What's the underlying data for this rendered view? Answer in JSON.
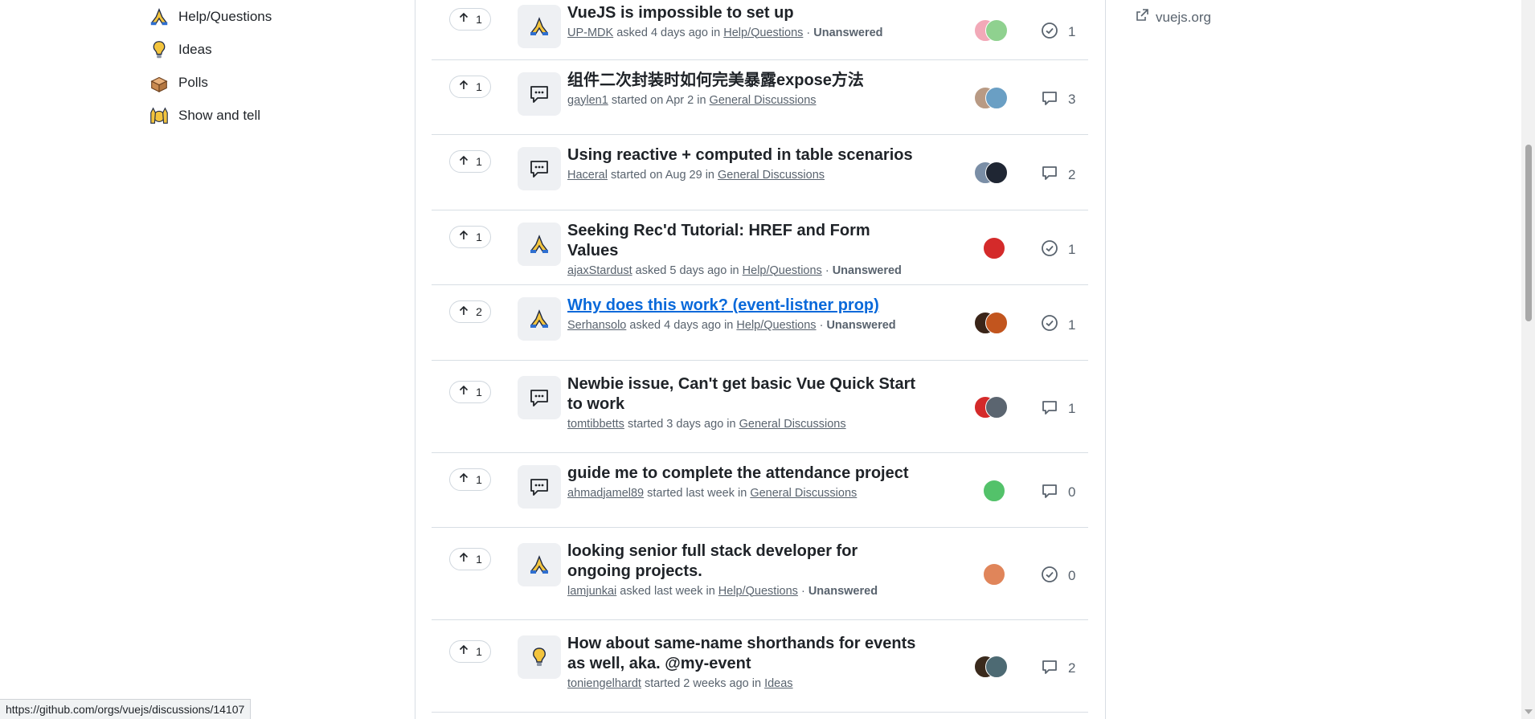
{
  "nav": {
    "items": [
      {
        "label": "Help/Questions",
        "icon": "folded-hands-icon"
      },
      {
        "label": "Ideas",
        "icon": "lightbulb-icon"
      },
      {
        "label": "Polls",
        "icon": "ballot-box-icon"
      },
      {
        "label": "Show and tell",
        "icon": "raising-hands-icon"
      }
    ]
  },
  "sidebar": {
    "link_label": "vuejs.org",
    "link_icon": "external-link-icon"
  },
  "discussions": [
    {
      "votes": "1",
      "category_icon": "folded-hands-icon",
      "title": "VueJS is impossible to set up",
      "author": "UP-MDK",
      "action": "asked 4 days ago in",
      "category": "Help/Questions",
      "status": "Unanswered",
      "count_icon": "check-circle-icon",
      "count": "1",
      "avatar_colors": [
        "#f2a9b8",
        "#8fd18f"
      ]
    },
    {
      "votes": "1",
      "category_icon": "speech-bubble-icon",
      "title": "组件二次封装时如何完美暴露expose方法",
      "author": "gaylen1",
      "action": "started on Apr 2 in",
      "category": "General Discussions",
      "status": "",
      "count_icon": "comment-icon",
      "count": "3",
      "avatar_colors": [
        "#b89a84",
        "#6a9fc4"
      ]
    },
    {
      "votes": "1",
      "category_icon": "speech-bubble-icon",
      "title": "Using reactive + computed in table scenarios",
      "author": "Haceral",
      "action": "started on Aug 29 in",
      "category": "General Discussions",
      "status": "",
      "count_icon": "comment-icon",
      "count": "2",
      "avatar_colors": [
        "#7a8ea6",
        "#1f2633"
      ]
    },
    {
      "votes": "1",
      "category_icon": "folded-hands-icon",
      "title": "Seeking Rec'd Tutorial: HREF and Form Values",
      "author": "ajaxStardust",
      "action": "asked 5 days ago in",
      "category": "Help/Questions",
      "status": "Unanswered",
      "count_icon": "check-circle-icon",
      "count": "1",
      "avatar_colors": [
        "#d42a2a"
      ]
    },
    {
      "votes": "2",
      "category_icon": "folded-hands-icon",
      "title": "Why does this work? (event-listner prop)",
      "author": "Serhansolo",
      "action": "asked 4 days ago in",
      "category": "Help/Questions",
      "status": "Unanswered",
      "count_icon": "check-circle-icon",
      "count": "1",
      "avatar_colors": [
        "#3a2418",
        "#c2551e"
      ]
    },
    {
      "votes": "1",
      "category_icon": "speech-bubble-icon",
      "title": "Newbie issue, Can't get basic Vue Quick Start to work",
      "author": "tomtibbetts",
      "action": "started 3 days ago in",
      "category": "General Discussions",
      "status": "",
      "count_icon": "comment-icon",
      "count": "1",
      "avatar_colors": [
        "#d42a2a",
        "#5b6570"
      ]
    },
    {
      "votes": "1",
      "category_icon": "speech-bubble-icon",
      "title": "guide me to complete the attendance project",
      "author": "ahmadjamel89",
      "action": "started last week in",
      "category": "General Discussions",
      "status": "",
      "count_icon": "comment-icon",
      "count": "0",
      "avatar_colors": [
        "#53c26a"
      ]
    },
    {
      "votes": "1",
      "category_icon": "folded-hands-icon",
      "title": "looking senior full stack developer for ongoing projects.",
      "author": "lamjunkai",
      "action": "asked last week in",
      "category": "Help/Questions",
      "status": "Unanswered",
      "count_icon": "check-circle-icon",
      "count": "0",
      "avatar_colors": [
        "#e0855a"
      ]
    },
    {
      "votes": "1",
      "category_icon": "lightbulb-icon",
      "title": "How about same-name shorthands for events as well, aka. @my-event",
      "author": "toniengelhardt",
      "action": "started 2 weeks ago in",
      "category": "Ideas",
      "status": "",
      "count_icon": "comment-icon",
      "count": "2",
      "avatar_colors": [
        "#3a2a1c",
        "#4d6a73"
      ]
    }
  ],
  "status_bar": {
    "url": "https://github.com/orgs/vuejs/discussions/14107"
  }
}
